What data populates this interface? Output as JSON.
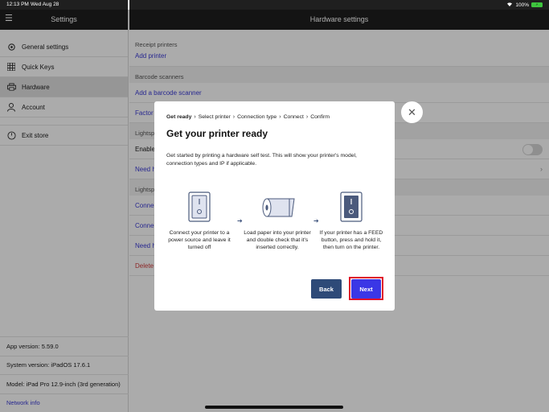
{
  "status_bar": {
    "time": "12:13 PM",
    "date": "Wed Aug 28",
    "battery": "100%",
    "wifi_icon": "wifi-icon"
  },
  "sidebar": {
    "title": "Settings",
    "items": [
      {
        "label": "General settings",
        "icon": "gear-icon"
      },
      {
        "label": "Quick Keys",
        "icon": "grid-icon"
      },
      {
        "label": "Hardware",
        "icon": "printer-icon",
        "active": true
      },
      {
        "label": "Account",
        "icon": "person-icon"
      },
      {
        "label": "Exit store",
        "icon": "exit-icon"
      }
    ],
    "footer": {
      "app_version": "App version: 5.59.0",
      "system_version": "System version: iPadOS 17.6.1",
      "model": "Model: iPad Pro 12.9-inch (3rd generation)",
      "network_info": "Network info"
    }
  },
  "main": {
    "title": "Hardware settings",
    "receipt_printers": {
      "label": "Receipt printers",
      "add_printer": "Add printer"
    },
    "barcode_scanners": {
      "label": "Barcode scanners",
      "add_scanner": "Add a barcode scanner",
      "factory": "Factor"
    },
    "lightspeed_1": {
      "label": "Lightsp",
      "enable": "Enable",
      "need": "Need h"
    },
    "lightspeed_2": {
      "label": "Lightsp",
      "connect1": "Connec",
      "connect2": "Connec",
      "need": "Need h",
      "delete": "Delete"
    }
  },
  "modal": {
    "breadcrumb": [
      "Get ready",
      "Select printer",
      "Connection type",
      "Connect",
      "Confirm"
    ],
    "title": "Get your printer ready",
    "description": "Get started by printing a hardware self test. This will show your printer's model, connection types and IP if applicable.",
    "steps": [
      {
        "text": "Connect your printer to a power source and leave it turned off"
      },
      {
        "text": "Load paper into your printer and double check that it's inserted correctly."
      },
      {
        "text": "If your printer has a FEED button, press and hold it, then turn on the printer."
      }
    ],
    "back_label": "Back",
    "next_label": "Next",
    "close_icon": "close-icon"
  },
  "colors": {
    "accent": "#3a37e6",
    "back": "#2e4a78",
    "highlight": "#e0102a",
    "header": "#1f1f1f"
  }
}
